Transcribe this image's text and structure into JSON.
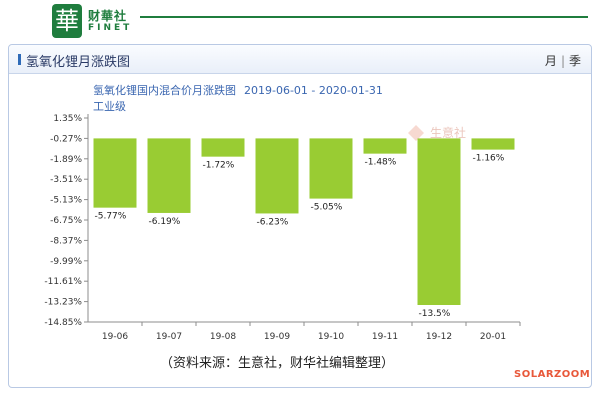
{
  "brand": {
    "logo_char": "華",
    "name_cn": "财華社",
    "name_en": "FINET"
  },
  "panel": {
    "title": "氢氧化锂月涨跌图",
    "period_month": "月",
    "period_separator": "|",
    "period_quarter": "季"
  },
  "watermark": "生意社",
  "source_note": "（资料来源：生意社，财华社编辑整理）",
  "corner_mark": "SOLARZOOM",
  "colors": {
    "bar": "#99cc33",
    "axis_text": "#333333",
    "subtitle": "#3a66b0",
    "brand": "#1f7d3e"
  },
  "chart_data": {
    "type": "bar",
    "title": "氢氧化锂国内混合价月涨跌图",
    "date_range": "2019-06-01 - 2020-01-31",
    "subtitle": "工业级",
    "categories": [
      "19-06",
      "19-07",
      "19-08",
      "19-09",
      "19-10",
      "19-11",
      "19-12",
      "20-01"
    ],
    "values": [
      -5.77,
      -6.19,
      -1.72,
      -6.23,
      -5.05,
      -1.48,
      -13.5,
      -1.16
    ],
    "value_labels": [
      "-5.77%",
      "-6.19%",
      "-1.72%",
      "-6.23%",
      "-5.05%",
      "-1.48%",
      "-13.5%",
      "-1.16%"
    ],
    "y_ticks": [
      1.35,
      -0.27,
      -1.89,
      -3.51,
      -5.13,
      -6.75,
      -8.37,
      -9.99,
      -11.61,
      -13.23,
      -14.85
    ],
    "y_tick_labels": [
      "1.35%",
      "-0.27%",
      "-1.89%",
      "-3.51%",
      "-5.13%",
      "-6.75%",
      "-8.37%",
      "-9.99%",
      "-11.61%",
      "-13.23%",
      "-14.85%"
    ],
    "ylim": [
      -14.85,
      1.35
    ],
    "baseline": -0.27,
    "grid": false,
    "legend": "none"
  }
}
